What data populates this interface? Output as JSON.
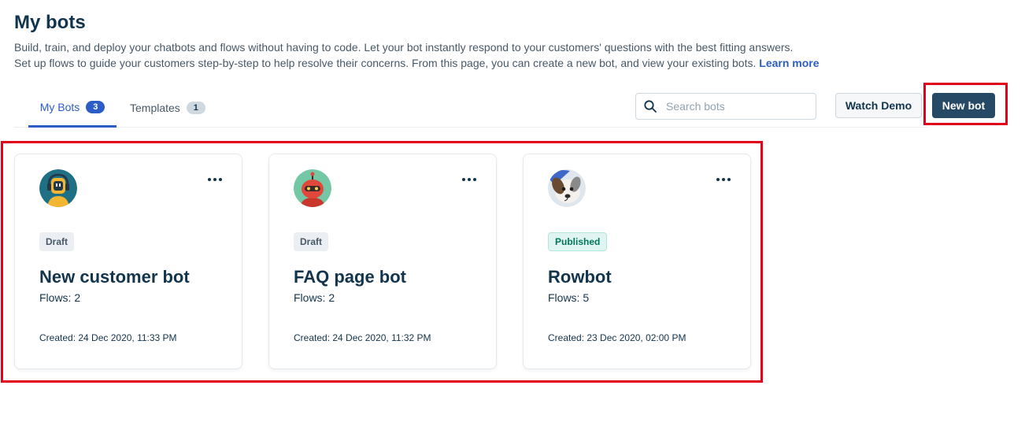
{
  "header": {
    "title": "My bots",
    "description_line1": "Build, train, and deploy your chatbots and flows without having to code. Let your bot instantly respond to your customers' questions with the best fitting answers.",
    "description_line2": "Set up flows to guide your customers step-by-step to help resolve their concerns. From this page, you can create a new bot, and view your existing bots.",
    "learn_more": "Learn more"
  },
  "tabs": [
    {
      "label": "My Bots",
      "count": "3",
      "active": true
    },
    {
      "label": "Templates",
      "count": "1",
      "active": false
    }
  ],
  "search": {
    "placeholder": "Search bots"
  },
  "toolbar": {
    "watch_demo": "Watch Demo",
    "new_bot": "New bot"
  },
  "bots": [
    {
      "status": "Draft",
      "name": "New customer bot",
      "flows": "Flows: 2",
      "created": "Created: 24 Dec 2020, 11:33 PM",
      "avatar_icon": "robot-headphones-avatar"
    },
    {
      "status": "Draft",
      "name": "FAQ page bot",
      "flows": "Flows: 2",
      "created": "Created: 24 Dec 2020, 11:32 PM",
      "avatar_icon": "red-robot-avatar"
    },
    {
      "status": "Published",
      "name": "Rowbot",
      "flows": "Flows: 5",
      "created": "Created: 23 Dec 2020, 02:00 PM",
      "avatar_icon": "dog-photo-avatar"
    }
  ],
  "colors": {
    "accent": "#2c5cc5",
    "primary_button": "#264966",
    "highlight": "#e3001b",
    "published": "#00795b"
  }
}
